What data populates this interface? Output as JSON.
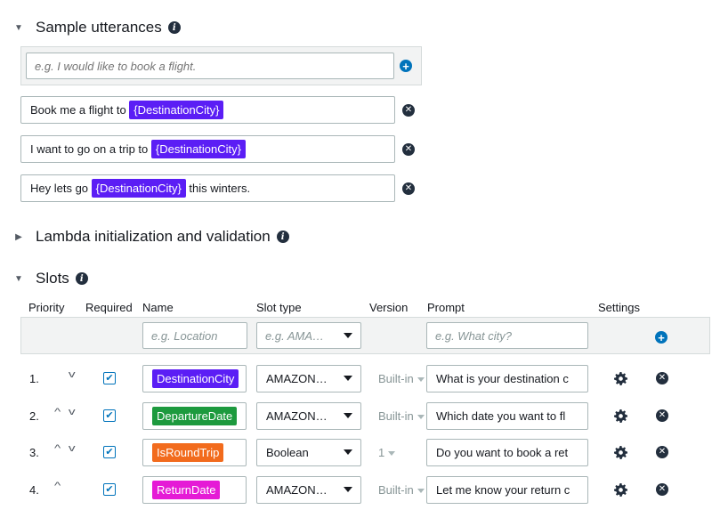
{
  "utterances": {
    "title": "Sample utterances",
    "placeholder": "e.g. I would like to book a flight.",
    "items": [
      {
        "before": "Book me a flight to",
        "slot": "{DestinationCity}",
        "after": ""
      },
      {
        "before": "I want to go on a trip to",
        "slot": "{DestinationCity}",
        "after": ""
      },
      {
        "before": "Hey lets go",
        "slot": "{DestinationCity}",
        "after": "this winters."
      }
    ]
  },
  "lambda": {
    "title": "Lambda initialization and validation"
  },
  "slots": {
    "title": "Slots",
    "headers": {
      "priority": "Priority",
      "required": "Required",
      "name": "Name",
      "slot_type": "Slot type",
      "version": "Version",
      "prompt": "Prompt",
      "settings": "Settings"
    },
    "new_row": {
      "name_placeholder": "e.g. Location",
      "type_placeholder": "e.g. AMA…",
      "prompt_placeholder": "e.g. What city?"
    },
    "rows": [
      {
        "priority": "1.",
        "up": false,
        "down": true,
        "required": true,
        "name": "DestinationCity",
        "color": "#5b1ef5",
        "slot_type": "AMAZON…",
        "version": "Built-in",
        "prompt": "What is your destination c"
      },
      {
        "priority": "2.",
        "up": true,
        "down": true,
        "required": true,
        "name": "DepartureDate",
        "color": "#1d9a3e",
        "slot_type": "AMAZON…",
        "version": "Built-in",
        "prompt": "Which date you want to fl"
      },
      {
        "priority": "3.",
        "up": true,
        "down": true,
        "required": true,
        "name": "IsRoundTrip",
        "color": "#f26b1d",
        "slot_type": "Boolean",
        "version": "1",
        "prompt": "Do you want to book a ret"
      },
      {
        "priority": "4.",
        "up": true,
        "down": false,
        "required": true,
        "name": "ReturnDate",
        "color": "#e51ad6",
        "slot_type": "AMAZON…",
        "version": "Built-in",
        "prompt": "Let me know your return c"
      }
    ]
  },
  "colors": {
    "utterance_slot": "#5b1ef5",
    "accent": "#0073bb"
  },
  "icons": [
    "caret-down-icon",
    "caret-right-icon",
    "info-icon",
    "plus-icon",
    "remove-icon",
    "gear-icon",
    "chevron-up-icon",
    "chevron-down-icon"
  ]
}
